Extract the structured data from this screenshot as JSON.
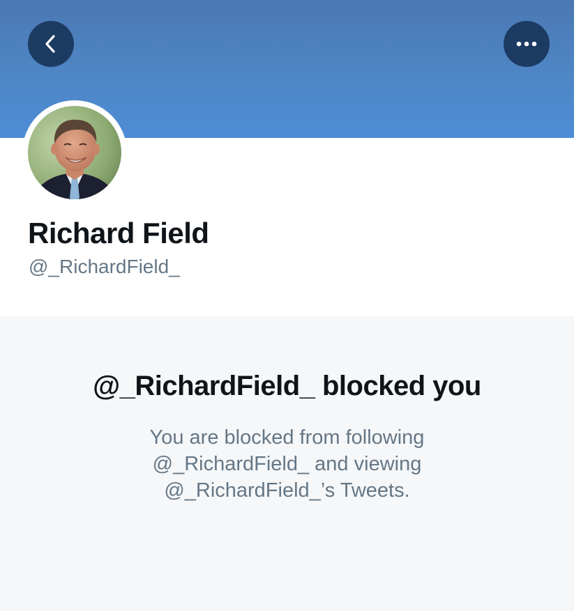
{
  "header": {
    "back_icon": "chevron-left-icon",
    "more_icon": "ellipsis-icon",
    "banner_color": "#4f86c6",
    "button_color": "#1c3b62"
  },
  "profile": {
    "display_name": "Richard Field",
    "handle": "@_RichardField_",
    "avatar": "profile-photo"
  },
  "blocked": {
    "title": "@_RichardField_ blocked you",
    "body_lines": [
      "You are blocked from following",
      "@_RichardField_ and viewing",
      "@_RichardField_’s Tweets."
    ]
  }
}
